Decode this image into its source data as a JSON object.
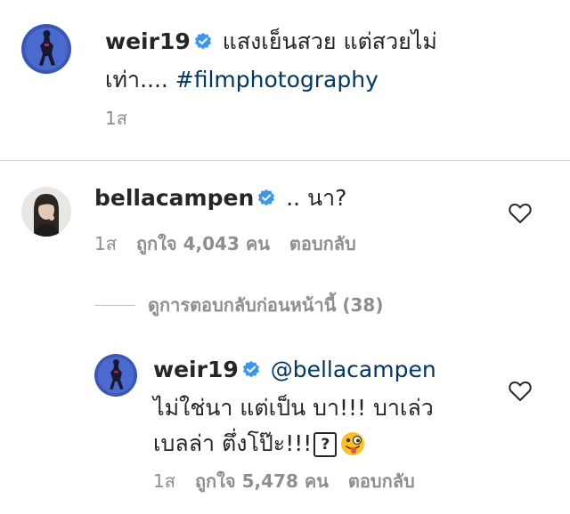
{
  "post": {
    "username": "weir19",
    "caption_line1": "แสงเย็นสวย แต่สวยไม่",
    "caption_line2": "เท่า.... ",
    "hashtag": "#filmphotography",
    "time": "1ส"
  },
  "comment": {
    "username": "bellacampen",
    "text": ".. นา?",
    "time": "1ส",
    "likes": "ถูกใจ 4,043 คน",
    "reply_label": "ตอบกลับ"
  },
  "view_replies": {
    "label": "ดูการตอบกลับก่อนหน้านี้ (38)"
  },
  "reply": {
    "username": "weir19",
    "mention": "@bellacampen",
    "text_line1": "ไม่ใช่นา แต่เป็น บา!!! บาเล่ว",
    "text_line2": "เบลล่า ตึ่งโป๊ะ!!!",
    "unknown_glyph": "?",
    "time": "1ส",
    "likes": "ถูกใจ 5,478 คน",
    "reply_label": "ตอบกลับ"
  },
  "icons": {
    "verified": "verified-badge-icon",
    "like": "heart-icon",
    "emoji": "tongue-out-face-icon"
  },
  "colors": {
    "verified": "#3897f0",
    "link": "#00376b",
    "secondary_text": "#8e8e8e",
    "divider": "#dbdbdb"
  }
}
